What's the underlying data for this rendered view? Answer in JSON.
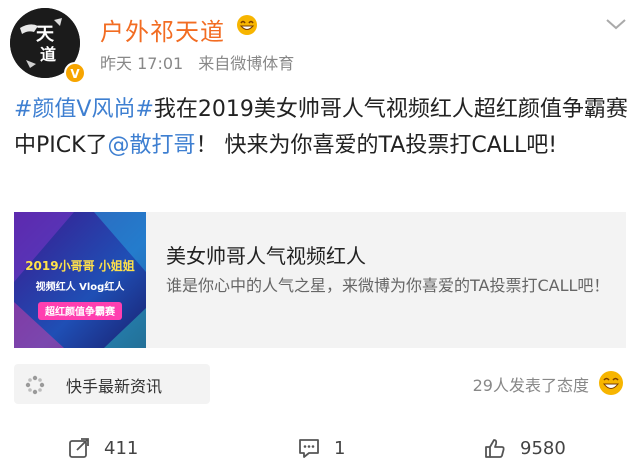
{
  "post": {
    "author": {
      "name": "户外祁天道",
      "avatar_text": "天道",
      "verified_badge": "V"
    },
    "timestamp": "昨天 17:01",
    "source": "来自微博体育",
    "content": {
      "topic": "#颜值V风尚#",
      "text_1": "我在2019美女帅哥人气视频红人超红颜值争霸赛中PICK了",
      "mention": "@散打哥",
      "text_2": "！ 快来为你喜爱的TA投票打CALL吧!"
    },
    "card": {
      "title": "美女帅哥人气视频红人",
      "description": "谁是你心中的人气之星，来微博为你喜爱的TA投票打CALL吧！",
      "thumb_line_1": "2019小哥哥 小姐姐",
      "thumb_line_2": "视频红人 Vlog红人",
      "thumb_line_3": "超红颜值争霸赛"
    },
    "source_tag": "快手最新资讯",
    "attitude_text": "29人发表了态度",
    "actions": {
      "repost_count": "411",
      "comment_count": "1",
      "like_count": "9580"
    }
  },
  "colors": {
    "name": "#f26c22",
    "link": "#3e7fd1",
    "verified": "#f7a500"
  },
  "icons": {
    "more": "chevron-down-icon",
    "source": "kuaishou-dots-icon",
    "repost": "share-icon",
    "comment": "comment-icon",
    "like": "thumbs-up-icon"
  }
}
